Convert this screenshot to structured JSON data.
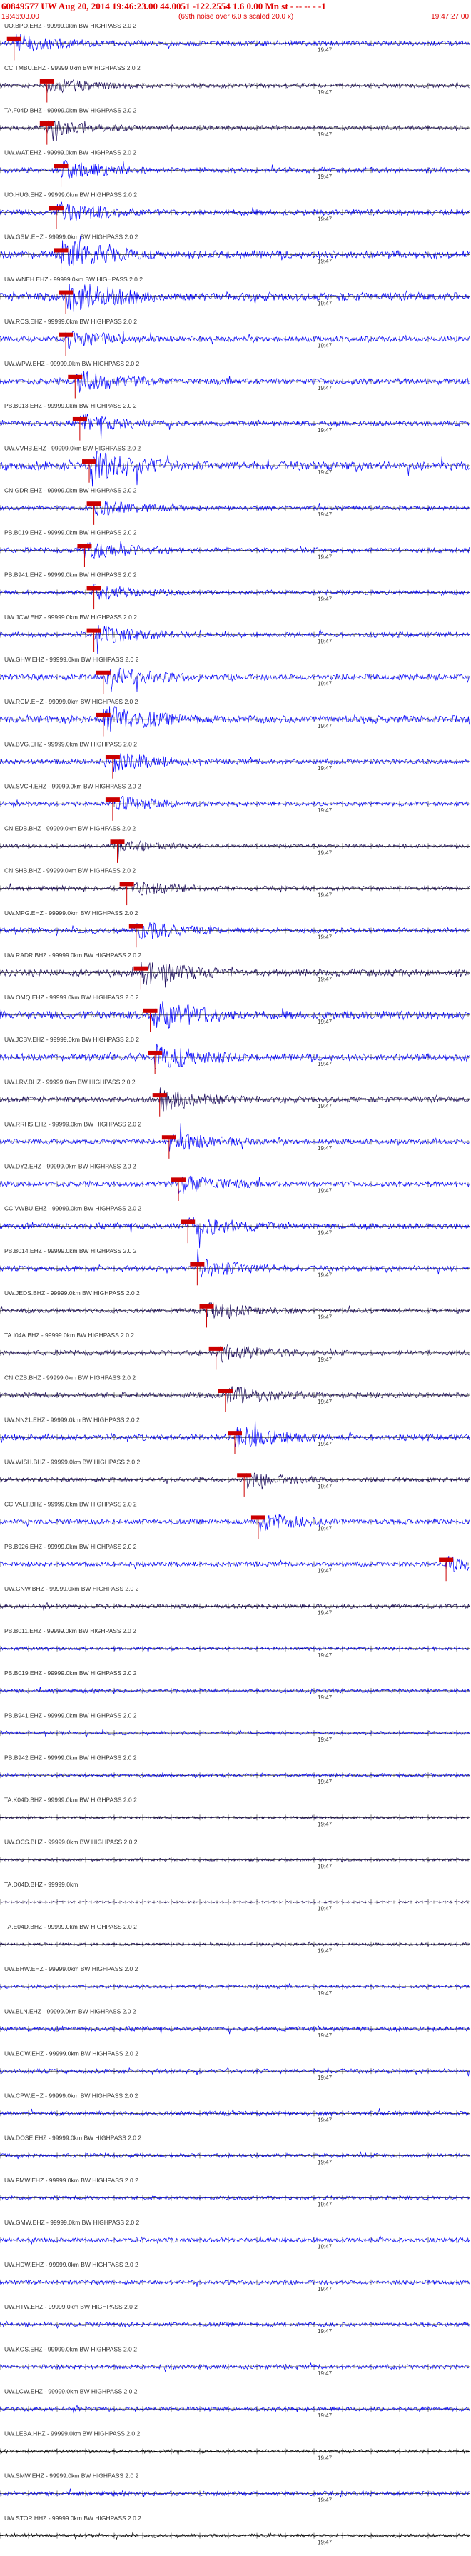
{
  "header": {
    "title": "60849577 UW Aug 20, 2014 19:46:23.00   44.0051  -122.2554   1.6 0.00 Mn st - -- -- - -1",
    "start_time": "19:46:03.00",
    "note": "(69th noise over 6.0 s scaled 20.0 x)",
    "end_time": "19:47:27.00"
  },
  "colors": {
    "header_text": "#e00000",
    "trace_blue": "#0000ff",
    "trace_dark": "#1a0a5a",
    "trace_black": "#000000",
    "pick_marker": "#cc0000",
    "baseline": "#000000",
    "label_text": "#333333"
  },
  "chart_data": {
    "type": "line",
    "x_label": "19:47",
    "stations": [
      {
        "label": "UO.BPO.EHZ - 99999.0km BW  HIGHPASS  2.0  2",
        "pick": 0.03,
        "amp": 0.6,
        "color": "blue"
      },
      {
        "label": "CC.TMBU.EHZ - 99999.0km BW  HIGHPASS  2.0  2",
        "pick": 0.1,
        "amp": 0.5,
        "color": "dark"
      },
      {
        "label": "TA.F04D.BHZ - 99999.0km BW  HIGHPASS  2.0  2",
        "pick": 0.1,
        "amp": 0.5,
        "color": "dark"
      },
      {
        "label": "UW.WAT.EHZ - 99999.0km BW  HIGHPASS  2.0  2",
        "pick": 0.13,
        "amp": 0.6,
        "color": "blue"
      },
      {
        "label": "UO.HUG.EHZ - 99999.0km BW  HIGHPASS  2.0  2",
        "pick": 0.12,
        "amp": 0.7,
        "color": "blue"
      },
      {
        "label": "UW.GSM.EHZ - 99999.0km BW  HIGHPASS  2.0  2",
        "pick": 0.13,
        "amp": 0.9,
        "color": "blue"
      },
      {
        "label": "UW.WNEH.EHZ - 99999.0km BW  HIGHPASS  2.0  2",
        "pick": 0.14,
        "amp": 1.0,
        "color": "blue"
      },
      {
        "label": "UW.RCS.EHZ - 99999.0km BW  HIGHPASS  2.0  2",
        "pick": 0.14,
        "amp": 0.6,
        "color": "blue"
      },
      {
        "label": "UW.WPW.EHZ - 99999.0km BW  HIGHPASS  2.0  2",
        "pick": 0.16,
        "amp": 0.7,
        "color": "blue"
      },
      {
        "label": "PB.B013.EHZ - 99999.0km BW  HIGHPASS  2.0  2",
        "pick": 0.17,
        "amp": 0.6,
        "color": "blue"
      },
      {
        "label": "UW.VVHB.EHZ - 99999.0km BW  HIGHPASS  2.0  2",
        "pick": 0.19,
        "amp": 1.0,
        "color": "blue"
      },
      {
        "label": "CN.GDR.EHZ - 99999.0km BW  HIGHPASS  2.0  2",
        "pick": 0.2,
        "amp": 0.5,
        "color": "blue"
      },
      {
        "label": "PB.B019.EHZ - 99999.0km BW  HIGHPASS  2.0  2",
        "pick": 0.18,
        "amp": 0.6,
        "color": "blue"
      },
      {
        "label": "PB.B941.EHZ - 99999.0km BW  HIGHPASS  2.0  2",
        "pick": 0.2,
        "amp": 0.5,
        "color": "blue"
      },
      {
        "label": "UW.JCW.EHZ - 99999.0km BW  HIGHPASS  2.0  2",
        "pick": 0.2,
        "amp": 0.6,
        "color": "blue"
      },
      {
        "label": "UW.GHW.EHZ - 99999.0km BW  HIGHPASS  2.0  2",
        "pick": 0.22,
        "amp": 0.7,
        "color": "blue"
      },
      {
        "label": "UW.RCM.EHZ - 99999.0km BW  HIGHPASS  2.0  2",
        "pick": 0.22,
        "amp": 0.9,
        "color": "blue"
      },
      {
        "label": "UW.BVG.EHZ - 99999.0km BW  HIGHPASS  2.0  2",
        "pick": 0.24,
        "amp": 0.6,
        "color": "blue"
      },
      {
        "label": "UW.SVCH.EHZ - 99999.0km BW  HIGHPASS  2.0  2",
        "pick": 0.24,
        "amp": 0.5,
        "color": "blue"
      },
      {
        "label": "CN.EDB.BHZ - 99999.0km BW  HIGHPASS  2.0  2",
        "pick": 0.25,
        "amp": 0.4,
        "color": "dark"
      },
      {
        "label": "CN.SHB.BHZ - 99999.0km BW  HIGHPASS  2.0  2",
        "pick": 0.27,
        "amp": 0.5,
        "color": "dark"
      },
      {
        "label": "UW.MPG.EHZ - 99999.0km BW  HIGHPASS  2.0  2",
        "pick": 0.29,
        "amp": 0.6,
        "color": "blue"
      },
      {
        "label": "UW.RADR.BHZ - 99999.0km BW  HIGHPASS  2.0  2",
        "pick": 0.3,
        "amp": 0.8,
        "color": "dark"
      },
      {
        "label": "UW.OMQ.EHZ - 99999.0km BW  HIGHPASS  2.0  2",
        "pick": 0.32,
        "amp": 1.0,
        "color": "blue"
      },
      {
        "label": "UW.JCBV.EHZ - 99999.0km BW  HIGHPASS  2.0  2",
        "pick": 0.33,
        "amp": 0.8,
        "color": "blue"
      },
      {
        "label": "UW.LRV.BHZ - 99999.0km BW  HIGHPASS  2.0  2",
        "pick": 0.34,
        "amp": 0.7,
        "color": "dark"
      },
      {
        "label": "UW.RRHS.EHZ - 99999.0km BW  HIGHPASS  2.0  2",
        "pick": 0.36,
        "amp": 0.6,
        "color": "blue"
      },
      {
        "label": "UW.DY2.EHZ - 99999.0km BW  HIGHPASS  2.0  2",
        "pick": 0.38,
        "amp": 0.6,
        "color": "blue"
      },
      {
        "label": "CC.VWBU.EHZ - 99999.0km BW  HIGHPASS  2.0  2",
        "pick": 0.4,
        "amp": 0.7,
        "color": "blue"
      },
      {
        "label": "PB.B014.EHZ - 99999.0km BW  HIGHPASS  2.0  2",
        "pick": 0.42,
        "amp": 0.6,
        "color": "blue"
      },
      {
        "label": "UW.JEDS.BHZ - 99999.0km BW  HIGHPASS  2.0  2",
        "pick": 0.44,
        "amp": 0.5,
        "color": "dark"
      },
      {
        "label": "TA.I04A.BHZ - 99999.0km BW  HIGHPASS  2.0  2",
        "pick": 0.46,
        "amp": 0.6,
        "color": "dark"
      },
      {
        "label": "CN.OZB.BHZ - 99999.0km BW  HIGHPASS  2.0  2",
        "pick": 0.48,
        "amp": 0.6,
        "color": "dark"
      },
      {
        "label": "UW.NN21.EHZ - 99999.0km BW  HIGHPASS  2.0  2",
        "pick": 0.5,
        "amp": 0.7,
        "color": "blue"
      },
      {
        "label": "UW.WISH.BHZ - 99999.0km BW  HIGHPASS  2.0  2",
        "pick": 0.52,
        "amp": 0.5,
        "color": "dark"
      },
      {
        "label": "CC.VALT.BHZ - 99999.0km BW  HIGHPASS  2.0  2",
        "pick": 0.55,
        "amp": 0.6,
        "color": "blue"
      },
      {
        "label": "PB.B926.EHZ - 99999.0km BW  HIGHPASS  2.0  2",
        "pick": 0.95,
        "amp": 0.5,
        "color": "blue"
      },
      {
        "label": "UW.GNW.BHZ - 99999.0km BW  HIGHPASS  2.0  2",
        "pick": null,
        "amp": 0.5,
        "color": "dark"
      },
      {
        "label": "PB.B011.EHZ - 99999.0km BW  HIGHPASS  2.0  2",
        "pick": null,
        "amp": 0.4,
        "color": "blue"
      },
      {
        "label": "PB.B019.EHZ - 99999.0km BW  HIGHPASS  2.0  2",
        "pick": null,
        "amp": 0.4,
        "color": "blue"
      },
      {
        "label": "PB.B941.EHZ - 99999.0km BW  HIGHPASS  2.0  2",
        "pick": null,
        "amp": 0.4,
        "color": "blue"
      },
      {
        "label": "PB.B942.EHZ - 99999.0km BW  HIGHPASS  2.0  2",
        "pick": null,
        "amp": 0.4,
        "color": "blue"
      },
      {
        "label": "TA.K04D.BHZ - 99999.0km BW  HIGHPASS  2.0  2",
        "pick": null,
        "amp": 0.3,
        "color": "dark"
      },
      {
        "label": "UW.OCS.BHZ - 99999.0km BW  HIGHPASS  2.0  2",
        "pick": null,
        "amp": 0.3,
        "color": "dark"
      },
      {
        "label": "TA.D04D.BHZ - 99999.0km",
        "pick": null,
        "amp": 0.2,
        "color": "dark"
      },
      {
        "label": "TA.E04D.BHZ - 99999.0km BW  HIGHPASS  2.0  2",
        "pick": null,
        "amp": 0.3,
        "color": "dark"
      },
      {
        "label": "UW.BHW.EHZ - 99999.0km BW  HIGHPASS  2.0  2",
        "pick": null,
        "amp": 0.4,
        "color": "blue"
      },
      {
        "label": "UW.BLN.EHZ - 99999.0km BW  HIGHPASS  2.0  2",
        "pick": null,
        "amp": 0.5,
        "color": "blue"
      },
      {
        "label": "UW.BOW.EHZ - 99999.0km BW  HIGHPASS  2.0  2",
        "pick": null,
        "amp": 0.5,
        "color": "blue"
      },
      {
        "label": "UW.CPW.EHZ - 99999.0km BW  HIGHPASS  2.0  2",
        "pick": null,
        "amp": 0.5,
        "color": "blue"
      },
      {
        "label": "UW.DOSE.EHZ - 99999.0km BW  HIGHPASS  2.0  2",
        "pick": null,
        "amp": 0.5,
        "color": "blue"
      },
      {
        "label": "UW.FMW.EHZ - 99999.0km BW  HIGHPASS  2.0  2",
        "pick": null,
        "amp": 0.4,
        "color": "blue"
      },
      {
        "label": "UW.GMW.EHZ - 99999.0km BW  HIGHPASS  2.0  2",
        "pick": null,
        "amp": 0.5,
        "color": "blue"
      },
      {
        "label": "UW.HDW.EHZ - 99999.0km BW  HIGHPASS  2.0  2",
        "pick": null,
        "amp": 0.5,
        "color": "blue"
      },
      {
        "label": "UW.HTW.EHZ - 99999.0km BW  HIGHPASS  2.0  2",
        "pick": null,
        "amp": 0.5,
        "color": "blue"
      },
      {
        "label": "UW.KOS.EHZ - 99999.0km BW  HIGHPASS  2.0  2",
        "pick": null,
        "amp": 0.5,
        "color": "blue"
      },
      {
        "label": "UW.LCW.EHZ - 99999.0km BW  HIGHPASS  2.0  2",
        "pick": null,
        "amp": 0.5,
        "color": "blue"
      },
      {
        "label": "UW.LEBA.HHZ - 99999.0km BW  HIGHPASS  2.0  2",
        "pick": null,
        "amp": 0.4,
        "color": "black"
      },
      {
        "label": "UW.SMW.EHZ - 99999.0km BW  HIGHPASS  2.0  2",
        "pick": null,
        "amp": 0.5,
        "color": "blue"
      },
      {
        "label": "UW.STOR.HHZ - 99999.0km BW  HIGHPASS  2.0  2",
        "pick": null,
        "amp": 0.4,
        "color": "black"
      }
    ]
  }
}
